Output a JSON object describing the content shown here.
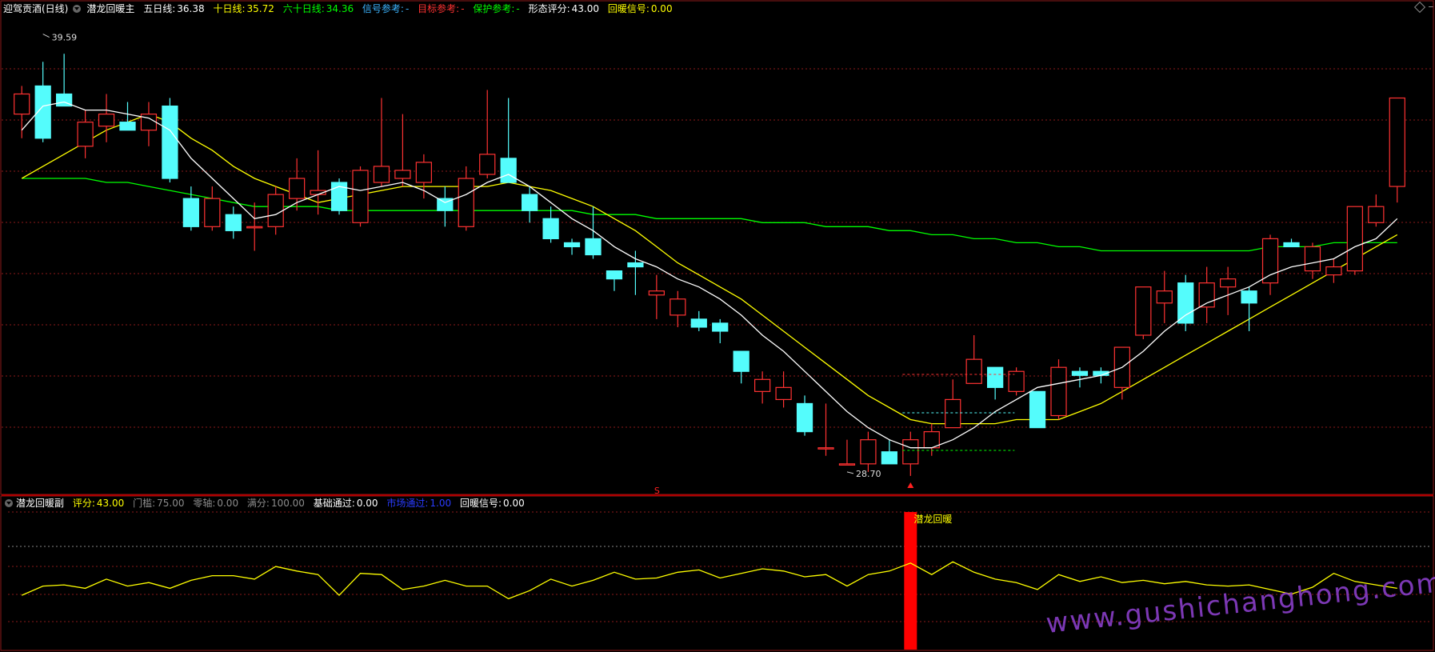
{
  "main_panel": {
    "stock_name": "迎驾贡酒(日线)",
    "indicator_name": "潜龙回暖主",
    "ma5_label": "五日线:",
    "ma5_value": "36.38",
    "ma10_label": "十日线:",
    "ma10_value": "35.72",
    "ma60_label": "六十日线:",
    "ma60_value": "34.36",
    "signal_ref_label": "信号参考:",
    "signal_ref_value": "-",
    "target_ref_label": "目标参考:",
    "target_ref_value": "-",
    "protect_ref_label": "保护参考:",
    "protect_ref_value": "-",
    "pattern_score_label": "形态评分:",
    "pattern_score_value": "43.00",
    "rebound_signal_label": "回暖信号:",
    "rebound_signal_value": "0.00",
    "high_marker": "39.59",
    "low_marker": "28.70",
    "s_marker": "S"
  },
  "sub_panel": {
    "indicator_name": "潜龙回暖副",
    "score_label": "评分:",
    "score_value": "43.00",
    "threshold_label": "门槛:",
    "threshold_value": "75.00",
    "zero_label": "零轴:",
    "zero_value": "0.00",
    "full_label": "满分:",
    "full_value": "100.00",
    "basic_pass_label": "基础通过:",
    "basic_pass_value": "0.00",
    "market_pass_label": "市场通过:",
    "market_pass_value": "1.00",
    "rebound_signal_label": "回暖信号:",
    "rebound_signal_value": "0.00",
    "signal_text": "潜龙回暖"
  },
  "watermark": "www.gushichanghong.com",
  "colors": {
    "up": "#ff3232",
    "down": "#54fcfc",
    "ma5": "#ffffff",
    "ma10": "#ffff00",
    "ma60": "#00ff00",
    "score": "#ffff00",
    "signal_bar": "#ff0000",
    "grid": "#8b1a1a"
  },
  "chart_data": [
    {
      "type": "candlestick",
      "title": "迎驾贡酒(日线)",
      "ylim": [
        28.2,
        40.0
      ],
      "candles": [
        [
          37.6,
          38.3,
          37.0,
          38.1
        ],
        [
          38.3,
          38.9,
          36.9,
          37.0
        ],
        [
          38.1,
          39.1,
          37.8,
          37.8
        ],
        [
          36.8,
          37.7,
          36.5,
          37.4
        ],
        [
          37.3,
          38.1,
          36.9,
          37.6
        ],
        [
          37.4,
          37.9,
          37.3,
          37.2
        ],
        [
          37.2,
          37.9,
          36.8,
          37.6
        ],
        [
          37.8,
          38.0,
          35.9,
          36.0
        ],
        [
          35.5,
          35.8,
          34.7,
          34.8
        ],
        [
          34.8,
          35.8,
          34.7,
          35.5
        ],
        [
          35.1,
          35.3,
          34.5,
          34.7
        ],
        [
          34.8,
          35.4,
          34.2,
          34.8
        ],
        [
          34.8,
          35.8,
          34.6,
          35.6
        ],
        [
          35.5,
          36.5,
          35.2,
          36.0
        ],
        [
          35.6,
          36.7,
          35.1,
          35.7
        ],
        [
          35.9,
          36.0,
          35.1,
          35.2
        ],
        [
          34.9,
          36.3,
          34.8,
          36.2
        ],
        [
          35.9,
          38.0,
          35.8,
          36.3
        ],
        [
          36.0,
          37.6,
          35.8,
          36.2
        ],
        [
          35.9,
          36.6,
          35.5,
          36.4
        ],
        [
          35.5,
          35.8,
          34.8,
          35.2
        ],
        [
          34.8,
          36.3,
          34.7,
          36.0
        ],
        [
          36.1,
          38.2,
          36.0,
          36.6
        ],
        [
          36.5,
          38.0,
          35.9,
          35.9
        ],
        [
          35.6,
          35.8,
          34.9,
          35.2
        ],
        [
          35.0,
          35.3,
          34.4,
          34.5
        ],
        [
          34.4,
          34.5,
          34.1,
          34.3
        ],
        [
          34.5,
          35.3,
          34.0,
          34.1
        ],
        [
          33.7,
          33.7,
          33.2,
          33.5
        ],
        [
          33.9,
          34.2,
          33.1,
          33.8
        ],
        [
          33.1,
          33.6,
          32.5,
          33.2
        ],
        [
          32.6,
          33.2,
          32.3,
          33.0
        ],
        [
          32.5,
          32.7,
          32.2,
          32.3
        ],
        [
          32.4,
          32.5,
          31.9,
          32.2
        ],
        [
          31.7,
          31.7,
          30.9,
          31.2
        ],
        [
          30.7,
          31.2,
          30.4,
          31.0
        ],
        [
          30.5,
          31.2,
          30.3,
          30.8
        ],
        [
          30.4,
          30.6,
          29.6,
          29.7
        ],
        [
          29.3,
          30.4,
          29.1,
          29.3
        ],
        [
          28.9,
          29.5,
          28.9,
          28.9
        ],
        [
          28.9,
          29.7,
          28.7,
          29.5
        ],
        [
          29.2,
          29.5,
          28.9,
          28.9
        ],
        [
          28.9,
          29.7,
          28.6,
          29.5
        ],
        [
          29.3,
          29.9,
          29.1,
          29.7
        ],
        [
          29.8,
          31.0,
          29.8,
          30.5
        ],
        [
          30.9,
          32.1,
          30.9,
          31.5
        ],
        [
          31.3,
          31.3,
          30.5,
          30.8
        ],
        [
          30.7,
          31.3,
          30.6,
          31.2
        ],
        [
          30.7,
          30.7,
          29.9,
          29.8
        ],
        [
          30.1,
          31.5,
          30.0,
          31.3
        ],
        [
          31.2,
          31.3,
          30.8,
          31.1
        ],
        [
          31.2,
          31.3,
          30.9,
          31.1
        ],
        [
          30.8,
          31.5,
          30.5,
          31.8
        ],
        [
          32.1,
          33.3,
          32.0,
          33.3
        ],
        [
          32.9,
          33.7,
          32.4,
          33.2
        ],
        [
          33.4,
          33.6,
          32.2,
          32.4
        ],
        [
          32.8,
          33.8,
          32.4,
          33.4
        ],
        [
          33.3,
          33.8,
          32.6,
          33.5
        ],
        [
          33.2,
          33.3,
          32.2,
          32.9
        ],
        [
          33.4,
          34.6,
          33.1,
          34.5
        ],
        [
          34.4,
          34.5,
          34.3,
          34.3
        ],
        [
          33.7,
          34.4,
          33.5,
          34.3
        ],
        [
          33.6,
          34.0,
          33.4,
          33.8
        ],
        [
          33.7,
          35.3,
          33.6,
          35.3
        ],
        [
          34.9,
          35.6,
          34.8,
          35.3
        ],
        [
          35.8,
          36.5,
          35.4,
          38.0
        ]
      ],
      "ma5": [
        37.2,
        37.8,
        37.9,
        37.7,
        37.7,
        37.6,
        37.5,
        37.2,
        36.5,
        36.0,
        35.5,
        35.0,
        35.1,
        35.4,
        35.6,
        35.8,
        35.7,
        35.8,
        35.9,
        35.7,
        35.4,
        35.6,
        35.9,
        36.1,
        35.8,
        35.4,
        35.0,
        34.7,
        34.3,
        34.0,
        33.8,
        33.5,
        33.3,
        33.0,
        32.6,
        32.1,
        31.7,
        31.2,
        30.7,
        30.2,
        29.8,
        29.5,
        29.3,
        29.3,
        29.5,
        29.8,
        30.2,
        30.5,
        30.8,
        30.9,
        31.0,
        31.1,
        31.3,
        31.7,
        32.2,
        32.6,
        32.9,
        33.1,
        33.3,
        33.6,
        33.8,
        33.9,
        34.0,
        34.3,
        34.5,
        35.0
      ],
      "ma10": [
        36.0,
        36.3,
        36.6,
        36.9,
        37.2,
        37.4,
        37.6,
        37.4,
        37.0,
        36.7,
        36.3,
        36.0,
        35.8,
        35.6,
        35.4,
        35.5,
        35.6,
        35.7,
        35.8,
        35.8,
        35.8,
        35.8,
        35.8,
        35.9,
        35.8,
        35.7,
        35.5,
        35.3,
        35.0,
        34.7,
        34.3,
        33.9,
        33.6,
        33.3,
        33.0,
        32.6,
        32.2,
        31.8,
        31.4,
        31.0,
        30.6,
        30.3,
        30.0,
        29.9,
        29.9,
        29.9,
        29.9,
        30.0,
        30.0,
        30.0,
        30.2,
        30.4,
        30.7,
        31.0,
        31.3,
        31.6,
        31.9,
        32.2,
        32.5,
        32.8,
        33.1,
        33.4,
        33.7,
        34.0,
        34.3,
        34.6
      ],
      "ma60": [
        36.0,
        36.0,
        36.0,
        36.0,
        35.9,
        35.9,
        35.8,
        35.7,
        35.6,
        35.5,
        35.4,
        35.3,
        35.3,
        35.3,
        35.3,
        35.2,
        35.2,
        35.2,
        35.2,
        35.2,
        35.2,
        35.2,
        35.2,
        35.2,
        35.2,
        35.2,
        35.2,
        35.1,
        35.1,
        35.1,
        35.0,
        35.0,
        35.0,
        35.0,
        35.0,
        34.9,
        34.9,
        34.9,
        34.8,
        34.8,
        34.8,
        34.7,
        34.7,
        34.6,
        34.6,
        34.5,
        34.5,
        34.4,
        34.4,
        34.3,
        34.3,
        34.2,
        34.2,
        34.2,
        34.2,
        34.2,
        34.2,
        34.2,
        34.2,
        34.3,
        34.3,
        34.3,
        34.4,
        34.4,
        34.4,
        34.4
      ]
    },
    {
      "type": "line",
      "title": "潜龙回暖副",
      "ylim": [
        0,
        100
      ],
      "threshold": 75,
      "series": [
        {
          "name": "评分",
          "values": [
            43,
            51,
            52,
            49,
            57,
            51,
            54,
            49,
            56,
            60,
            60,
            57,
            68,
            64,
            61,
            43,
            62,
            61,
            48,
            51,
            56,
            51,
            51,
            40,
            47,
            57,
            51,
            56,
            63,
            57,
            58,
            63,
            65,
            58,
            62,
            66,
            64,
            59,
            61,
            51,
            61,
            64,
            71,
            61,
            72,
            63,
            57,
            54,
            48,
            61,
            55,
            59,
            54,
            56,
            53,
            55,
            52,
            51,
            52,
            48,
            44,
            50,
            62,
            55,
            52,
            49
          ]
        }
      ],
      "signal_bar_index": 42,
      "signal_bar_label": "潜龙回暖"
    }
  ]
}
